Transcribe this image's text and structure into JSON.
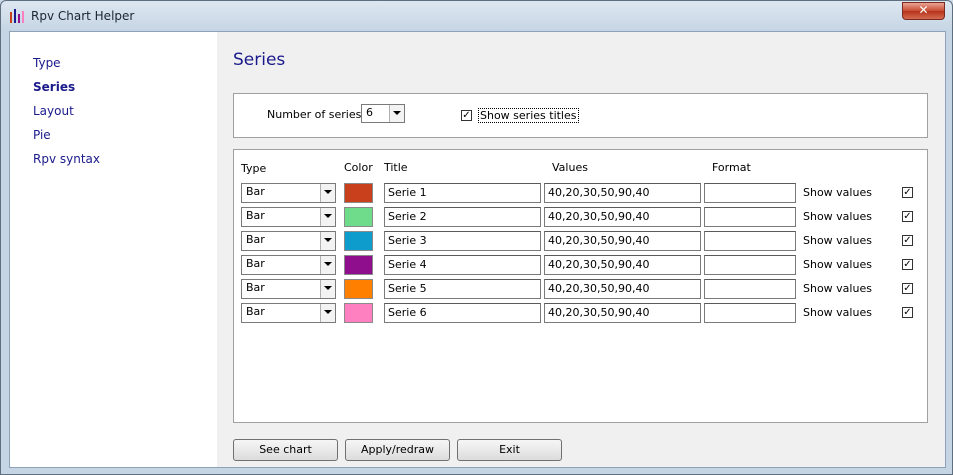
{
  "window": {
    "title": "Rpv Chart Helper",
    "close_glyph": "✕"
  },
  "sidebar": {
    "items": [
      {
        "label": "Type",
        "active": false
      },
      {
        "label": "Series",
        "active": true
      },
      {
        "label": "Layout",
        "active": false
      },
      {
        "label": "Pie",
        "active": false
      },
      {
        "label": "Rpv syntax",
        "active": false
      }
    ]
  },
  "main": {
    "heading": "Series",
    "number_of_series_label": "Number of series",
    "number_of_series_value": "6",
    "show_series_titles_label": "Show series titles",
    "show_series_titles_checked": true
  },
  "table": {
    "headers": {
      "type": "Type",
      "color": "Color",
      "title": "Title",
      "values": "Values",
      "format": "Format"
    },
    "show_values_label": "Show values",
    "rows": [
      {
        "type": "Bar",
        "color": "#c8401c",
        "title": "Serie 1",
        "values": "40,20,30,50,90,40",
        "format": "",
        "show_values": true
      },
      {
        "type": "Bar",
        "color": "#6fdc8c",
        "title": "Serie 2",
        "values": "40,20,30,50,90,40",
        "format": "",
        "show_values": true
      },
      {
        "type": "Bar",
        "color": "#0e9ccd",
        "title": "Serie 3",
        "values": "40,20,30,50,90,40",
        "format": "",
        "show_values": true
      },
      {
        "type": "Bar",
        "color": "#8e0e8e",
        "title": "Serie 4",
        "values": "40,20,30,50,90,40",
        "format": "",
        "show_values": true
      },
      {
        "type": "Bar",
        "color": "#ff8000",
        "title": "Serie 5",
        "values": "40,20,30,50,90,40",
        "format": "",
        "show_values": true
      },
      {
        "type": "Bar",
        "color": "#ff80c0",
        "title": "Serie 6",
        "values": "40,20,30,50,90,40",
        "format": "",
        "show_values": true
      }
    ]
  },
  "buttons": {
    "see_chart": "See chart",
    "apply": "Apply/redraw",
    "exit": "Exit"
  }
}
